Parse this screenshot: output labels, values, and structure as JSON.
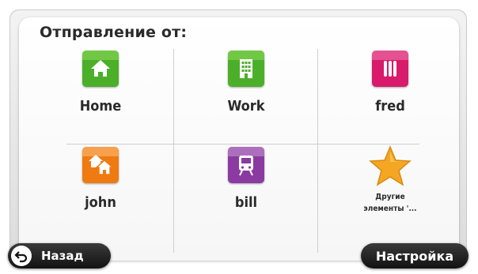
{
  "header": {
    "title": "Отправление от:"
  },
  "items": [
    {
      "label": "Home",
      "icon": "home-icon",
      "color": "#4caf2a"
    },
    {
      "label": "Work",
      "icon": "building-icon",
      "color": "#4caf2a"
    },
    {
      "label": "fred",
      "icon": "favorite-bars-icon",
      "color": "#d81b6a"
    },
    {
      "label": "john",
      "icon": "houses-icon",
      "color": "#f07a12"
    },
    {
      "label": "bill",
      "icon": "train-icon",
      "color": "#8a3aa0"
    },
    {
      "label": "Другие\nэлементы '...",
      "icon": "star-icon",
      "color": "#f5a623"
    }
  ],
  "footer": {
    "back_label": "Назад",
    "settings_label": "Настройка"
  }
}
